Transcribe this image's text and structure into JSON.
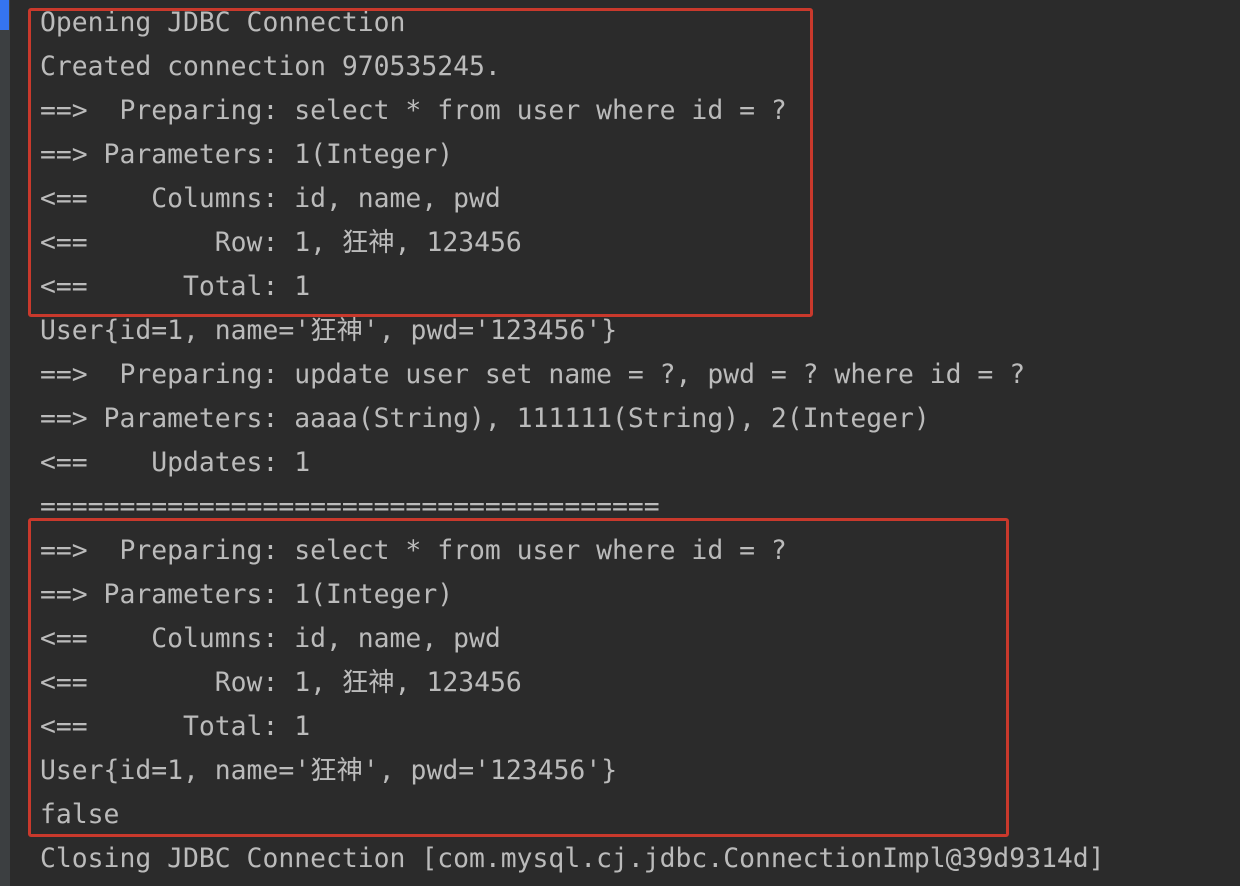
{
  "console": {
    "lines": [
      "Opening JDBC Connection",
      "Created connection 970535245.",
      "==>  Preparing: select * from user where id = ?",
      "==> Parameters: 1(Integer)",
      "<==    Columns: id, name, pwd",
      "<==        Row: 1, 狂神, 123456",
      "<==      Total: 1",
      "User{id=1, name='狂神', pwd='123456'}",
      "==>  Preparing: update user set name = ?, pwd = ? where id = ?",
      "==> Parameters: aaaa(String), 111111(String), 2(Integer)",
      "<==    Updates: 1",
      "=======================================",
      "==>  Preparing: select * from user where id = ?",
      "==> Parameters: 1(Integer)",
      "<==    Columns: id, name, pwd",
      "<==        Row: 1, 狂神, 123456",
      "<==      Total: 1",
      "User{id=1, name='狂神', pwd='123456'}",
      "false",
      "Closing JDBC Connection [com.mysql.cj.jdbc.ConnectionImpl@39d9314d]"
    ]
  },
  "colors": {
    "background": "#2b2b2b",
    "text": "#bbbbbb",
    "highlight_box": "#c9392c"
  }
}
